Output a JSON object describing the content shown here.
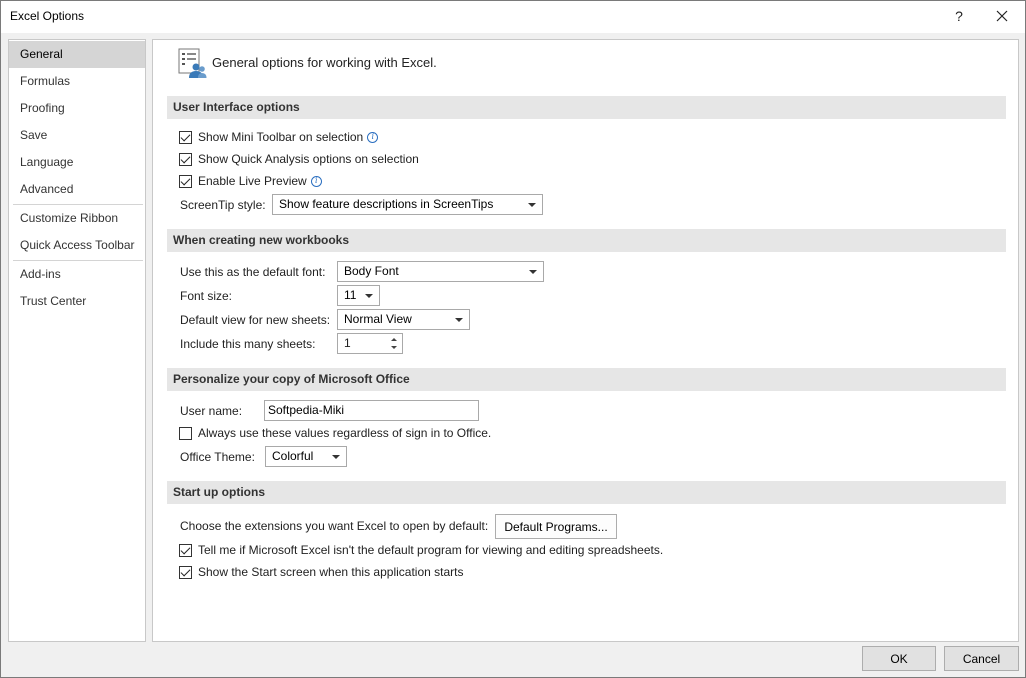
{
  "window": {
    "title": "Excel Options"
  },
  "titlebar": {
    "help_label": "?",
    "close_label": "✕"
  },
  "nav": {
    "items": [
      {
        "label": "General",
        "selected": true
      },
      {
        "label": "Formulas"
      },
      {
        "label": "Proofing"
      },
      {
        "label": "Save"
      },
      {
        "label": "Language"
      },
      {
        "label": "Advanced"
      },
      {
        "label": "Customize Ribbon"
      },
      {
        "label": "Quick Access Toolbar"
      },
      {
        "label": "Add-ins"
      },
      {
        "label": "Trust Center"
      }
    ]
  },
  "main": {
    "header": "General options for working with Excel.",
    "ui_section": {
      "title": "User Interface options",
      "mini_toolbar": {
        "label": "Show Mini Toolbar on selection",
        "checked": true
      },
      "quick_analysis": {
        "label": "Show Quick Analysis options on selection",
        "checked": true
      },
      "live_preview": {
        "label": "Enable Live Preview",
        "checked": true
      },
      "screentip_label": "ScreenTip style:",
      "screentip_value": "Show feature descriptions in ScreenTips"
    },
    "workbook_section": {
      "title": "When creating new workbooks",
      "font_label": "Use this as the default font:",
      "font_value": "Body Font",
      "size_label": "Font size:",
      "size_value": "11",
      "view_label": "Default view for new sheets:",
      "view_value": "Normal View",
      "sheets_label": "Include this many sheets:",
      "sheets_value": "1"
    },
    "personalize_section": {
      "title": "Personalize your copy of Microsoft Office",
      "username_label": "User name:",
      "username_value": "Softpedia-Miki",
      "always_use": {
        "label": "Always use these values regardless of sign in to Office.",
        "checked": false
      },
      "theme_label": "Office Theme:",
      "theme_value": "Colorful"
    },
    "startup_section": {
      "title": "Start up options",
      "extensions_label": "Choose the extensions you want Excel to open by default:",
      "default_programs_button": "Default Programs...",
      "tell_me": {
        "label": "Tell me if Microsoft Excel isn't the default program for viewing and editing spreadsheets.",
        "checked": true
      },
      "show_start": {
        "label": "Show the Start screen when this application starts",
        "checked": true
      }
    }
  },
  "footer": {
    "ok_label": "OK",
    "cancel_label": "Cancel"
  },
  "colors": {
    "section_bar": "#e6e6e6",
    "nav_selected": "#d5d5d5",
    "info_icon": "#2b6fc0"
  }
}
